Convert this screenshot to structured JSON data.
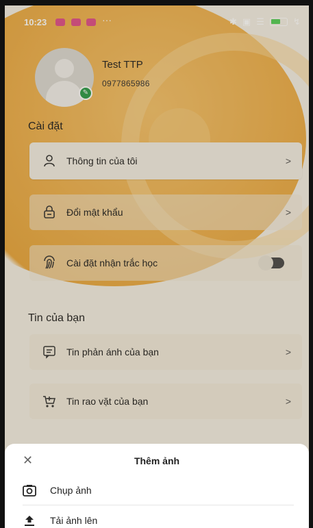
{
  "status_bar": {
    "time": "10:23",
    "more": "···",
    "battery": "53"
  },
  "profile": {
    "name": "Test TTP",
    "phone": "0977865986"
  },
  "settings_section": {
    "title": "Cài đặt",
    "items": [
      {
        "label": "Thông tin của tôi",
        "icon": "user-icon",
        "trailing": ">"
      },
      {
        "label": "Đổi mật khẩu",
        "icon": "lock-icon",
        "trailing": ">"
      },
      {
        "label": "Cài đặt nhận trắc học",
        "icon": "fingerprint-icon",
        "toggle_on": false
      }
    ]
  },
  "news_section": {
    "title": "Tin của bạn",
    "items": [
      {
        "label": "Tin phản ánh của bạn",
        "icon": "message-icon",
        "trailing": ">"
      },
      {
        "label": "Tin rao vặt của bạn",
        "icon": "cart-icon",
        "trailing": ">"
      }
    ]
  },
  "bottom_sheet": {
    "close": "✕",
    "title": "Thêm ảnh",
    "items": [
      {
        "label": "Chụp ảnh",
        "icon": "camera-icon"
      },
      {
        "label": "Tải ảnh lên",
        "icon": "upload-icon"
      }
    ]
  },
  "colors": {
    "accent": "#eeb04d",
    "edit_badge": "#2c9c4b",
    "notification": "#e0508a",
    "battery": "#56d05a"
  }
}
